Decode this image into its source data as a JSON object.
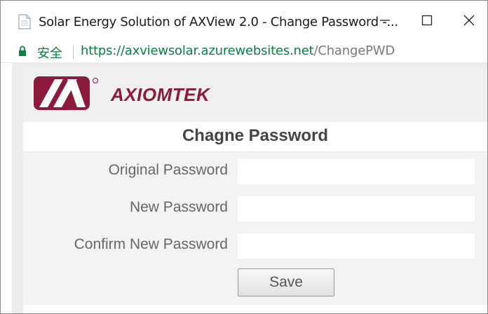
{
  "window": {
    "title": "Solar Energy Solution of AXView 2.0 - Change Password -...",
    "controls": [
      "minimize",
      "maximize",
      "close"
    ]
  },
  "address_bar": {
    "secure_label": "安全",
    "url_host": "https://axviewsolar.azurewebsites.net",
    "url_path": "/ChangePWD",
    "secure_color": "#0b8043"
  },
  "brand": {
    "logo_text": "AXIOMTEK",
    "color": "#8c1a3a"
  },
  "page": {
    "heading": "Chagne Password"
  },
  "form": {
    "original_label": "Original Password",
    "original_value": "",
    "new_label": "New Password",
    "new_value": "",
    "confirm_label": "Confirm New Password",
    "confirm_value": "",
    "save_label": "Save"
  },
  "icons": [
    "document-icon",
    "minimize-icon",
    "maximize-icon",
    "close-icon",
    "lock-icon",
    "axiomtek-logo-icon"
  ]
}
